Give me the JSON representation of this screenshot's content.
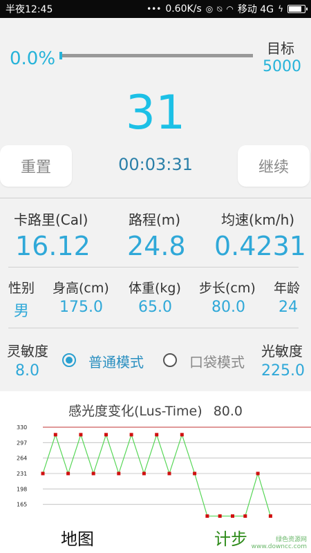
{
  "status_bar": {
    "time": "半夜12:45",
    "network_speed": "0.60K/s",
    "carrier": "移动 4G"
  },
  "progress": {
    "percent_text": "0.0%",
    "fraction": 0.0,
    "goal_label": "目标",
    "goal_value": "5000"
  },
  "step_count": "31",
  "buttons": {
    "reset": "重置",
    "continue": "继续"
  },
  "timer": "00:03:31",
  "stats": {
    "calories_label": "卡路里(Cal)",
    "calories": "16.12",
    "distance_label": "路程(m)",
    "distance": "24.8",
    "speed_label": "均速(km/h)",
    "speed": "0.4231"
  },
  "profile": {
    "gender_label": "性别",
    "gender": "男",
    "height_label": "身高(cm)",
    "height": "175.0",
    "weight_label": "体重(kg)",
    "weight": "65.0",
    "stride_label": "步长(cm)",
    "stride": "80.0",
    "age_label": "年龄",
    "age": "24"
  },
  "settings": {
    "sensitivity_label": "灵敏度",
    "sensitivity": "8.0",
    "mode_normal": "普通模式",
    "mode_pocket": "口袋模式",
    "mode_selected": "normal",
    "light_label": "光敏度",
    "light": "225.0"
  },
  "chart_data": {
    "type": "line",
    "title": "感光度变化(Lus-Time)",
    "title_value": "80.0",
    "y_ticks": [
      330,
      297,
      264,
      231,
      198,
      165
    ],
    "reference_line": 330,
    "x": [
      0,
      1,
      2,
      3,
      4,
      5,
      6,
      7,
      8,
      9,
      10,
      11,
      12,
      13,
      14,
      15,
      16,
      17,
      18
    ],
    "y": [
      231,
      314,
      231,
      314,
      231,
      314,
      231,
      314,
      231,
      314,
      231,
      314,
      231,
      140,
      140,
      140,
      140,
      231,
      140
    ],
    "colors": {
      "line": "#55d655",
      "marker": "#d01010",
      "reference": "#c03030"
    }
  },
  "bottom_nav": {
    "map": "地图",
    "steps": "计步"
  },
  "watermark": {
    "line1": "绿色资源网",
    "line2": "www.downcc.com"
  },
  "theme": {
    "accent": "#26b3d9"
  }
}
